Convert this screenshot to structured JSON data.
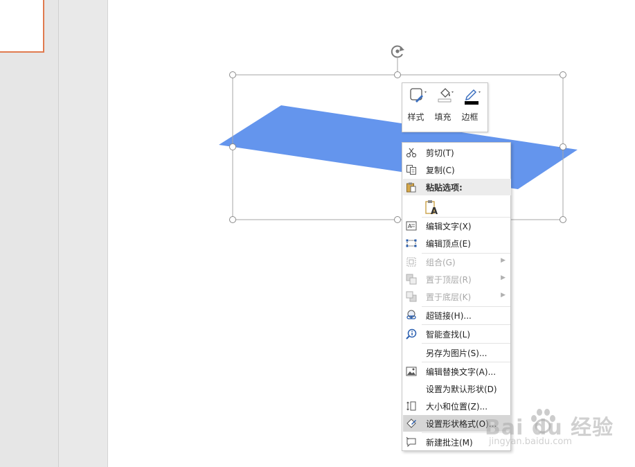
{
  "mini_toolbar": {
    "style_label": "样式",
    "fill_label": "填充",
    "border_label": "边框"
  },
  "context_menu": {
    "items": [
      {
        "label": "剪切(T)",
        "icon": "scissors-icon",
        "enabled": true
      },
      {
        "label": "复制(C)",
        "icon": "copy-icon",
        "enabled": true
      },
      {
        "label": "粘贴选项:",
        "icon": "paste-icon",
        "enabled": true
      },
      {
        "label": "编辑文字(X)",
        "icon": "edit-text-icon",
        "enabled": true
      },
      {
        "label": "编辑顶点(E)",
        "icon": "edit-points-icon",
        "enabled": true
      },
      {
        "label": "组合(G)",
        "icon": "group-icon",
        "enabled": false
      },
      {
        "label": "置于顶层(R)",
        "icon": "bring-to-front-icon",
        "enabled": false
      },
      {
        "label": "置于底层(K)",
        "icon": "send-to-back-icon",
        "enabled": false
      },
      {
        "label": "超链接(H)...",
        "icon": "hyperlink-icon",
        "enabled": true
      },
      {
        "label": "智能查找(L)",
        "icon": "smart-lookup-icon",
        "enabled": true
      },
      {
        "label": "另存为图片(S)...",
        "icon": "",
        "enabled": true
      },
      {
        "label": "编辑替换文字(A)...",
        "icon": "alt-text-icon",
        "enabled": true
      },
      {
        "label": "设置为默认形状(D)",
        "icon": "",
        "enabled": true
      },
      {
        "label": "大小和位置(Z)...",
        "icon": "size-position-icon",
        "enabled": true
      },
      {
        "label": "设置形状格式(O)...",
        "icon": "format-shape-icon",
        "enabled": true
      },
      {
        "label": "新建批注(M)",
        "icon": "new-comment-icon",
        "enabled": true
      }
    ]
  },
  "watermark": {
    "main": "Bai du 经验",
    "sub": "jingyan.baidu.com"
  },
  "colors": {
    "shape_fill": "#6495ed",
    "thumbnail_border": "#e07a4e",
    "hover": "#d6d6d6"
  }
}
